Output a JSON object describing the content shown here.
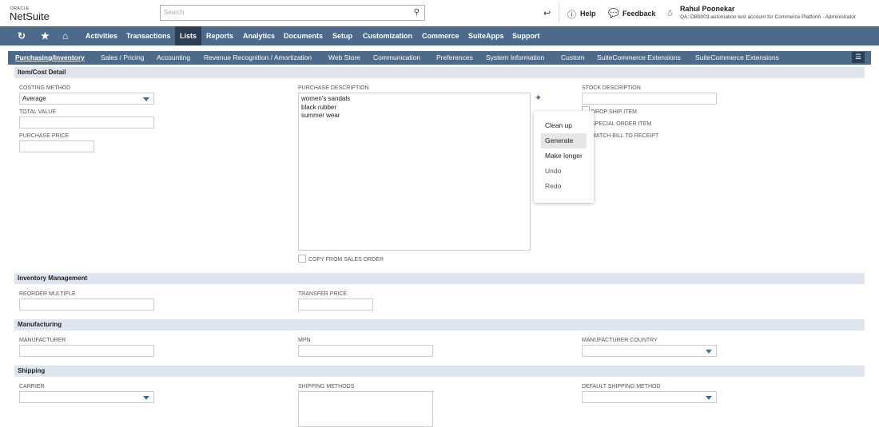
{
  "header": {
    "logo_top": "ORACLE",
    "logo_bottom": "NetSuite",
    "search_placeholder": "Search",
    "help": "Help",
    "feedback": "Feedback",
    "user_name": "Rahul Poonekar",
    "user_account": "QA: DB9003 automation test account for Commerce Platform - Administrator"
  },
  "nav": [
    "Activities",
    "Transactions",
    "Lists",
    "Reports",
    "Analytics",
    "Documents",
    "Setup",
    "Customization",
    "Commerce",
    "SuiteApps",
    "Support"
  ],
  "nav_active": "Lists",
  "subtabs": [
    "Purchasing/Inventory",
    "Sales / Pricing",
    "Accounting",
    "Revenue Recognition / Amortization",
    "Web Store",
    "Communication",
    "Preferences",
    "System Information",
    "Custom",
    "SuiteCommerce Extensions",
    "SuiteCommerce Extensions"
  ],
  "sections": {
    "item_cost": "Item/Cost Detail",
    "inventory": "Inventory Management",
    "manufacturing": "Manufacturing",
    "shipping": "Shipping"
  },
  "fields": {
    "costing_method": "COSTING METHOD",
    "costing_value": "Average",
    "total_value": "TOTAL VALUE",
    "purchase_price": "PURCHASE PRICE",
    "purchase_description": "PURCHASE DESCRIPTION",
    "purchase_lines": [
      "women's sandals",
      "black rubber",
      "summer wear"
    ],
    "copy_from_so": "COPY FROM SALES ORDER",
    "stock_description": "STOCK DESCRIPTION",
    "drop_ship": "DROP SHIP ITEM",
    "special_order": "SPECIAL ORDER ITEM",
    "match_bill": "MATCH BILL TO RECEIPT",
    "reorder_multiple": "REORDER MULTIPLE",
    "transfer_price": "TRANSFER PRICE",
    "manufacturer": "MANUFACTURER",
    "mpn": "MPN",
    "manufacturer_country": "MANUFACTURER COUNTRY",
    "carrier": "CARRIER",
    "shipping_methods": "SHIPPING METHODS",
    "default_shipping": "DEFAULT SHIPPING METHOD"
  },
  "ai_menu": {
    "items": [
      "Clean up",
      "Generate",
      "Make longer",
      "Undo",
      "Redo"
    ],
    "highlighted": "Generate"
  },
  "colors": {
    "nav": "#4d6a8b",
    "nav_active": "#2d3e52",
    "section": "#dfe5ee"
  }
}
